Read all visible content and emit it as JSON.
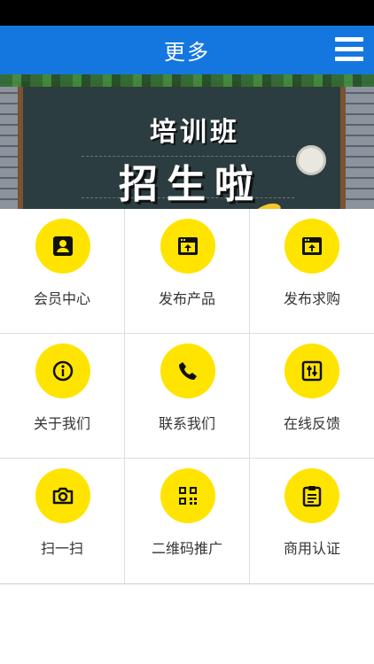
{
  "header": {
    "title": "更多",
    "menu_icon": "hamburger-menu-icon"
  },
  "banner": {
    "line1": "培训班",
    "line2": "招生啦"
  },
  "colors": {
    "header": "#1477e0",
    "icon_circle": "#ffe400",
    "statusbar": "#000000"
  },
  "menu": [
    {
      "label": "会员中心",
      "icon": "member-card-icon"
    },
    {
      "label": "发布产品",
      "icon": "upload-window-icon"
    },
    {
      "label": "发布求购",
      "icon": "upload-window-icon"
    },
    {
      "label": "关于我们",
      "icon": "info-icon"
    },
    {
      "label": "联系我们",
      "icon": "phone-icon"
    },
    {
      "label": "在线反馈",
      "icon": "sliders-icon"
    },
    {
      "label": "扫一扫",
      "icon": "camera-icon"
    },
    {
      "label": "二维码推广",
      "icon": "qrcode-icon"
    },
    {
      "label": "商用认证",
      "icon": "clipboard-icon"
    }
  ]
}
